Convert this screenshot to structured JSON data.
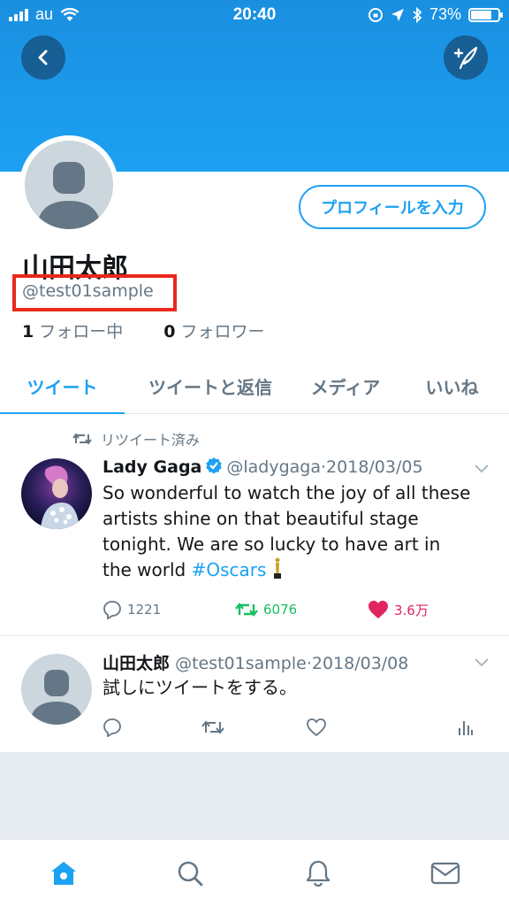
{
  "status_bar": {
    "carrier": "au",
    "time": "20:40",
    "battery": "73%",
    "battery_level": 0.73
  },
  "header": {
    "back_icon": "chevron-left-icon",
    "compose_icon": "compose-tweet-icon"
  },
  "profile": {
    "edit_button": "プロフィールを入力",
    "name": "山田太郎",
    "handle": "@test01sample",
    "following_count": "1",
    "following_label": "フォロー中",
    "followers_count": "0",
    "followers_label": "フォロワー"
  },
  "tabs": [
    {
      "label": "ツイート",
      "active": true
    },
    {
      "label": "ツイートと返信",
      "active": false
    },
    {
      "label": "メディア",
      "active": false
    },
    {
      "label": "いいね",
      "active": false
    }
  ],
  "tweets": [
    {
      "retweet_label": "リツイート済み",
      "name": "Lady Gaga",
      "handle": "@ladygaga",
      "date": "·2018/03/05",
      "text": "So wonderful to watch the joy of all these artists shine on that beautiful stage tonight. We are so lucky to have art in the world ",
      "hashtag": "#Oscars",
      "replies": "1221",
      "retweets": "6076",
      "likes": "3.6万"
    },
    {
      "name": "山田太郎",
      "handle": "@test01sample",
      "date": "·2018/03/08",
      "text": "試しにツイートをする。"
    }
  ],
  "colors": {
    "accent": "#1da1f2",
    "retweet": "#17bf63",
    "like": "#e0245e",
    "highlight_box": "#e8281c"
  }
}
